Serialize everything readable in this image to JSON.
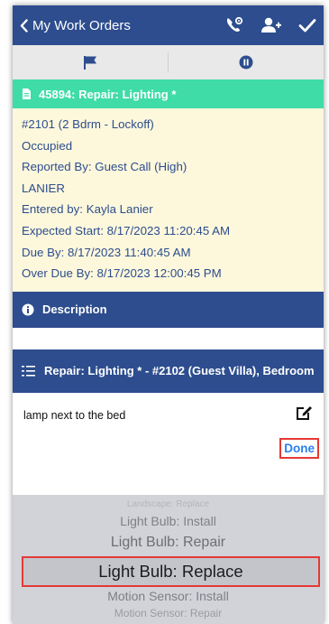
{
  "navbar": {
    "back_label": "My Work Orders",
    "icons": [
      "chevron-left-icon",
      "phone-settings-icon",
      "add-user-icon",
      "checkmark-icon"
    ]
  },
  "subbar": {
    "icons": [
      "flag-icon",
      "pause-icon"
    ]
  },
  "work_order": {
    "header": "45894: Repair: Lighting *",
    "details": [
      "#2101 (2 Bdrm - Lockoff)",
      "Occupied",
      "Reported By: Guest Call  (High)",
      "LANIER",
      "Entered by: Kayla Lanier",
      "Expected Start: 8/17/2023 11:20:45 AM",
      "Due By: 8/17/2023 11:40:45 AM",
      "Over Due By: 8/17/2023 12:00:45 PM"
    ]
  },
  "description": {
    "label": "Description"
  },
  "task": {
    "title": "Repair: Lighting * - #2102 (Guest Villa), Bedroom",
    "note": "lamp next to the bed",
    "done_label": "Done"
  },
  "picker": {
    "options": [
      "Landscape: Replace",
      "Light Bulb: Install",
      "Light Bulb: Repair",
      "Light Bulb: Replace",
      "Motion Sensor: Install",
      "Motion Sensor: Repair"
    ],
    "selected": "Light Bulb: Replace"
  },
  "colors": {
    "nav_blue": "#2d4d8e",
    "header_green": "#3fdca8",
    "details_bg": "#fdf8dc",
    "highlight_red": "#e53935",
    "done_blue": "#2a7ff0",
    "picker_bg": "#d1d3d8"
  }
}
